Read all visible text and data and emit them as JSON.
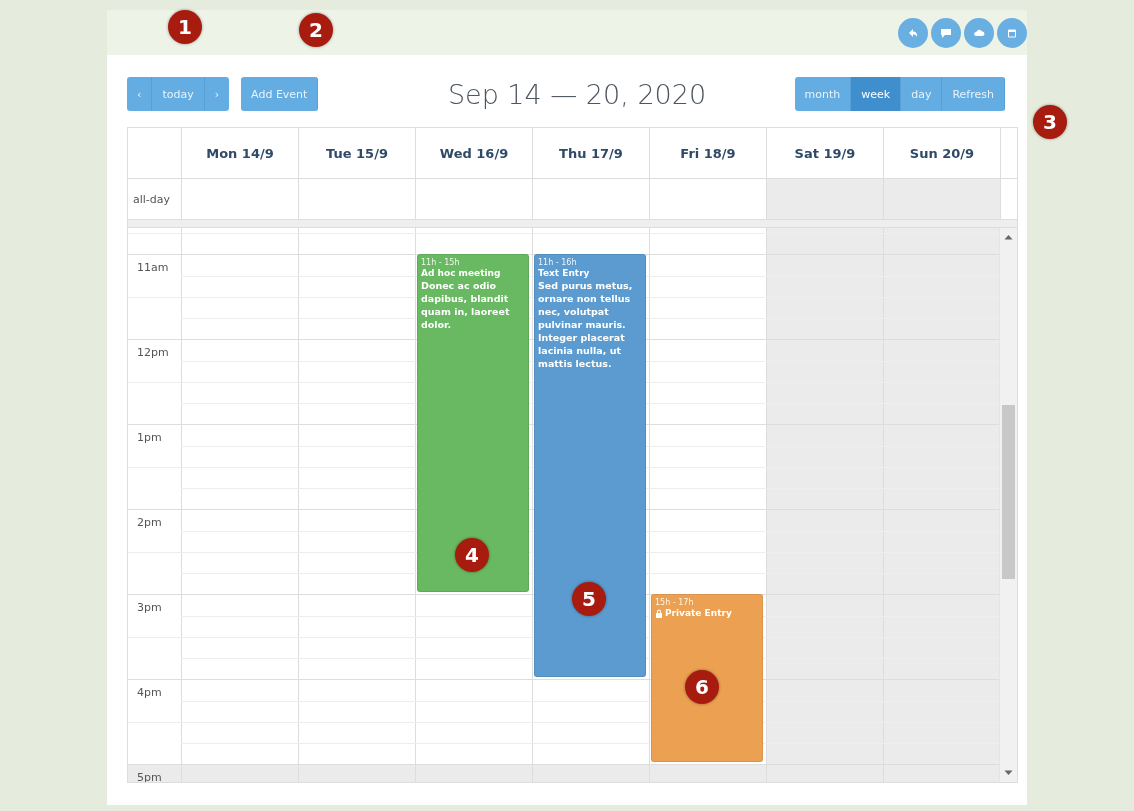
{
  "toolbar": {
    "prev": "‹",
    "today": "today",
    "next": "›",
    "add_event": "Add Event",
    "title": "Sep 14 — 20, 2020",
    "views": [
      {
        "label": "month",
        "selected": false
      },
      {
        "label": "week",
        "selected": true
      },
      {
        "label": "day",
        "selected": false
      },
      {
        "label": "Refresh",
        "selected": false
      }
    ]
  },
  "days": [
    {
      "label": "Mon 14/9",
      "shaded": false
    },
    {
      "label": "Tue 15/9",
      "shaded": false
    },
    {
      "label": "Wed 16/9",
      "shaded": false,
      "events": [
        {
          "time": "11h - 15h",
          "title": "Ad hoc meeting",
          "description": "Donec ac odio dapibus, blandit quam in, laoreet dolor.",
          "color": "#69b862",
          "private": false
        }
      ]
    },
    {
      "label": "Thu 17/9",
      "shaded": false,
      "events": [
        {
          "time": "11h - 16h",
          "title": "Text Entry",
          "description": "Sed purus metus, ornare non tellus nec, volutpat pulvinar mauris. Integer placerat lacinia nulla, ut mattis lectus.",
          "color": "#5b9bcf",
          "private": false
        }
      ]
    },
    {
      "label": "Fri 18/9",
      "shaded": false,
      "events": [
        {
          "time": "15h - 17h",
          "title": "Private Entry",
          "color": "#eca052",
          "private": true
        }
      ]
    },
    {
      "label": "Sat 19/9",
      "shaded": true
    },
    {
      "label": "Sun 20/9",
      "shaded": true
    }
  ],
  "all_day_label": "all-day",
  "hours": [
    {
      "label": "11am",
      "shaded": false
    },
    {
      "label": "12pm",
      "shaded": false
    },
    {
      "label": "1pm",
      "shaded": false
    },
    {
      "label": "2pm",
      "shaded": false
    },
    {
      "label": "3pm",
      "shaded": false
    },
    {
      "label": "4pm",
      "shaded": false
    },
    {
      "label": "5pm",
      "shaded": true
    }
  ],
  "callouts": [
    {
      "label": "1"
    },
    {
      "label": "2"
    },
    {
      "label": "3"
    },
    {
      "label": "4"
    },
    {
      "label": "5"
    },
    {
      "label": "6"
    }
  ]
}
